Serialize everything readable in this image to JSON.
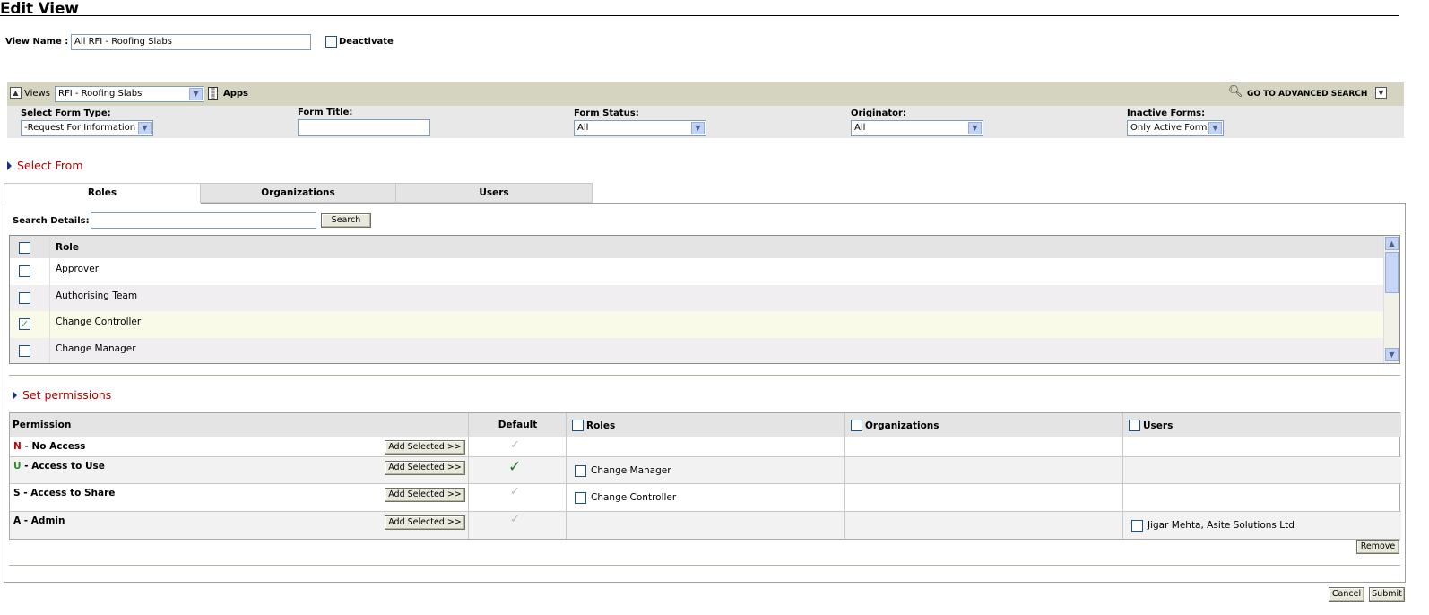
{
  "page": {
    "title": "Edit View"
  },
  "view_name": {
    "label": "View Name :",
    "value": "All RFI - Roofing Slabs",
    "deactivate_label": "Deactivate"
  },
  "views_bar": {
    "views_label": "Views",
    "selected_view": "RFI - Roofing Slabs",
    "apps_label": "Apps",
    "advanced_search_label": "GO TO ADVANCED SEARCH"
  },
  "filters": {
    "form_type": {
      "label": "Select Form Type:",
      "value": "-Request For Information"
    },
    "form_title": {
      "label": "Form Title:",
      "value": ""
    },
    "form_status": {
      "label": "Form Status:",
      "value": "All"
    },
    "originator": {
      "label": "Originator:",
      "value": "All"
    },
    "inactive_forms": {
      "label": "Inactive Forms:",
      "value": "Only Active Forms"
    }
  },
  "select_from": {
    "heading": "Select From",
    "tabs": [
      {
        "label": "Roles",
        "active": true
      },
      {
        "label": "Organizations",
        "active": false
      },
      {
        "label": "Users",
        "active": false
      }
    ],
    "search_label": "Search Details:",
    "search_value": "",
    "search_button": "Search",
    "column_header": "Role",
    "rows": [
      {
        "label": "Approver",
        "checked": false
      },
      {
        "label": "Authorising Team",
        "checked": false
      },
      {
        "label": "Change Controller",
        "checked": true
      },
      {
        "label": "Change Manager",
        "checked": false
      }
    ]
  },
  "permissions": {
    "heading": "Set permissions",
    "columns": {
      "permission": "Permission",
      "default": "Default",
      "roles": "Roles",
      "organizations": "Organizations",
      "users": "Users"
    },
    "add_button_label": "Add Selected >>",
    "rows": [
      {
        "code": "N",
        "name": " - No Access",
        "code_color": "#cc0000",
        "default": "grey",
        "roles": [],
        "organizations": [],
        "users": []
      },
      {
        "code": "U",
        "name": " - Access to Use",
        "code_color": "#2d8a2d",
        "default": "green",
        "roles": [
          "Change Manager"
        ],
        "organizations": [],
        "users": []
      },
      {
        "code": "S",
        "name": " - Access to Share",
        "code_color": "#000000",
        "default": "grey",
        "roles": [
          "Change Controller"
        ],
        "organizations": [],
        "users": []
      },
      {
        "code": "A",
        "name": " - Admin",
        "code_color": "#000000",
        "default": "grey",
        "roles": [],
        "organizations": [],
        "users": [
          "Jigar Mehta, Asite Solutions Ltd"
        ]
      }
    ],
    "remove_button": "Remove"
  },
  "footer": {
    "cancel_button": "Cancel",
    "submit_button": "Submit"
  },
  "colors": {
    "section_heading": "#b00000",
    "views_bar": "#d4d4c0",
    "filters_bar": "#e8e8e8",
    "table_header": "#e4e4e4",
    "selected_row": "#fafae8"
  }
}
